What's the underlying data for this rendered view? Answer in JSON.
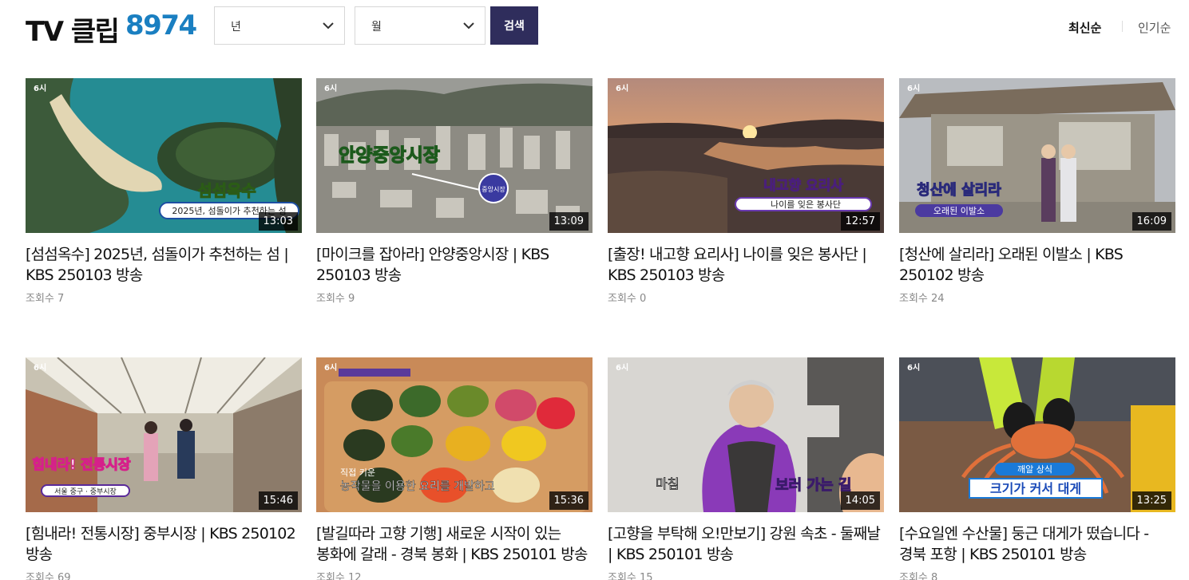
{
  "header": {
    "title": "TV 클립",
    "count": "8974",
    "year_select": "년",
    "month_select": "월",
    "search_label": "검색",
    "sort_latest": "최신순",
    "sort_popular": "인기순"
  },
  "clips": [
    {
      "title": "[섬섬옥수] 2025년, 섬돌이가 추천하는 섬 | KBS 250103 방송",
      "duration": "13:03",
      "views": "조회수 7",
      "overlay_main": "섬섬옥수",
      "overlay_sub": "2025년, 섬돌이가 추천하는 섬"
    },
    {
      "title": "[마이크를 잡아라] 안양중앙시장 | KBS 250103 방송",
      "duration": "13:09",
      "views": "조회수 9",
      "overlay_main": "안양중앙시장",
      "overlay_sub": "중앙시장"
    },
    {
      "title": "[출장! 내고향 요리사] 나이를 잊은 봉사단 | KBS 250103 방송",
      "duration": "12:57",
      "views": "조회수 0",
      "overlay_main": "내고향 요리사",
      "overlay_sub": "나이를 잊은 봉사단"
    },
    {
      "title": "[청산에 살리라] 오래된 이발소 | KBS 250102 방송",
      "duration": "16:09",
      "views": "조회수 24",
      "overlay_main": "청산에 살리라",
      "overlay_sub": "오래된 이발소"
    },
    {
      "title": "[힘내라! 전통시장] 중부시장 | KBS 250102 방송",
      "duration": "15:46",
      "views": "조회수 69",
      "overlay_main": "힘내라! 전통시장",
      "overlay_sub": "서울 중구 · 중부시장"
    },
    {
      "title": "[발길따라 고향 기행] 새로운 시작이 있는 봉화에 갈래 - 경북 봉화 | KBS 250101 방송",
      "duration": "15:36",
      "views": "조회수 12",
      "overlay_main": "농작물을 이용한 요리를 개발하고",
      "overlay_sub": "직접 키운"
    },
    {
      "title": "[고향을 부탁해 오!만보기] 강원 속초 - 둘째날 | KBS 250101 방송",
      "duration": "14:05",
      "views": "조회수 15",
      "overlay_main": "보러 가는 길",
      "overlay_sub": "마침"
    },
    {
      "title": "[수요일엔 수산물] 둥근 대게가 떴습니다 - 경북 포항 | KBS 250101 방송",
      "duration": "13:25",
      "views": "조회수 8",
      "overlay_main": "크기가 커서 대게",
      "overlay_sub": "깨알 상식"
    }
  ],
  "colors": {
    "accent_blue": "#1a7fc1",
    "button_navy": "#2f2d5c"
  }
}
